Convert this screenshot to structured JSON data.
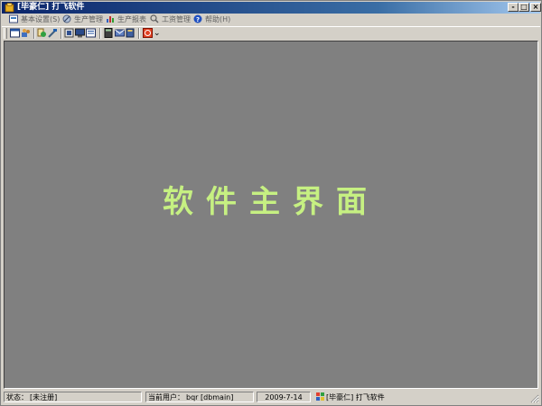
{
  "window": {
    "title": "[毕豪仁] 打飞软件",
    "controls": {
      "minimize": "-",
      "maximize": "□",
      "close": "×"
    }
  },
  "menu": {
    "items": [
      {
        "label": "基本设置",
        "key": "(S)",
        "icon": "settings-icon"
      },
      {
        "label": "生产管理",
        "key": "",
        "icon": "production-icon"
      },
      {
        "label": "生产报表",
        "key": "",
        "icon": "report-icon"
      },
      {
        "label": "工资管理",
        "key": "",
        "icon": "salary-icon"
      },
      {
        "label": "帮助",
        "key": "(H)",
        "icon": "help-icon"
      }
    ]
  },
  "toolbar": {
    "buttons": [
      "new-window-icon",
      "users-icon",
      "user-edit-icon",
      "tools-icon",
      "form-icon",
      "monitor-icon",
      "list-icon",
      "calculator-icon",
      "mail-icon",
      "book-icon",
      "power-icon"
    ],
    "dropdown": "⌄"
  },
  "main": {
    "heading": "软件主界面",
    "background": "#808080",
    "heading_color": "#c6f082"
  },
  "status": {
    "state_label": "状态：",
    "state_value": "[未注册]",
    "user_label": "当前用户：",
    "user_value": "bqr [dbmain]",
    "date": "2009-7-14",
    "app_title": "[毕豪仁] 打飞软件"
  }
}
